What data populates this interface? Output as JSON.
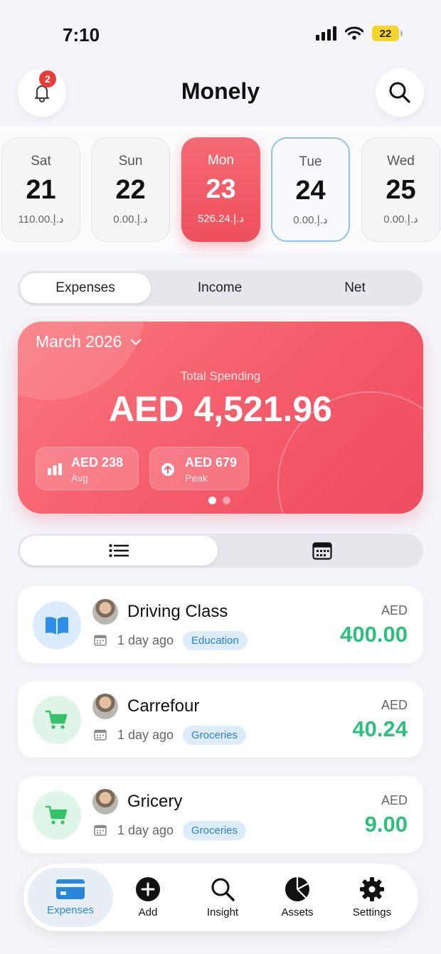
{
  "status": {
    "time": "7:10",
    "battery": "22"
  },
  "header": {
    "title": "Monely",
    "notification_count": "2"
  },
  "days": [
    {
      "name": "Sat",
      "num": "21",
      "amount": "110.00.د.إ"
    },
    {
      "name": "Sun",
      "num": "22",
      "amount": "0.00.د.إ"
    },
    {
      "name": "Mon",
      "num": "23",
      "amount": "526.24.د.إ"
    },
    {
      "name": "Tue",
      "num": "24",
      "amount": "0.00.د.إ"
    },
    {
      "name": "Wed",
      "num": "25",
      "amount": "0.00.د.إ"
    }
  ],
  "segment": {
    "expenses": "Expenses",
    "income": "Income",
    "net": "Net"
  },
  "summary": {
    "month": "March 2026",
    "total_label": "Total Spending",
    "total": "AED 4,521.96",
    "avg_value": "AED 238",
    "avg_label": "Avg",
    "peak_value": "AED 679",
    "peak_label": "Peak"
  },
  "transactions": [
    {
      "name": "Driving Class",
      "time": "1 day ago",
      "tag": "Education",
      "currency": "AED",
      "amount": "400.00",
      "icon": "book-icon"
    },
    {
      "name": "Carrefour",
      "time": "1 day ago",
      "tag": "Groceries",
      "currency": "AED",
      "amount": "40.24",
      "icon": "cart-icon"
    },
    {
      "name": "Gricery",
      "time": "1 day ago",
      "tag": "Groceries",
      "currency": "AED",
      "amount": "9.00",
      "icon": "cart-icon"
    }
  ],
  "tabs": {
    "expenses": "Expenses",
    "add": "Add",
    "insight": "Insight",
    "assets": "Assets",
    "settings": "Settings"
  },
  "colors": {
    "accent": "#ef4f5c",
    "income_green": "#2fbf7d",
    "tab_blue": "#2a86d8",
    "tag_blue": "#2d80c6"
  }
}
